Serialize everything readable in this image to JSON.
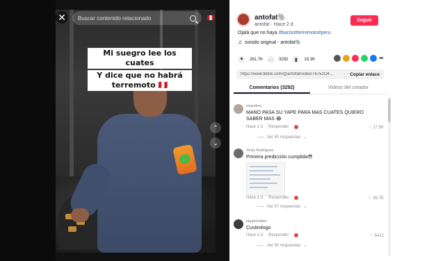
{
  "search": {
    "placeholder": "Buscar contenido relacionado"
  },
  "video": {
    "caption_line1": "Mi suegro lee los cuates",
    "caption_line2": "Y dice que no habrá terremoto 🇵🇪"
  },
  "author": {
    "name": "antofat🐘",
    "sub": "antofat · Hace 2 d",
    "follow_label": "Seguir"
  },
  "post": {
    "description_text": "Ojalá que no haya",
    "hashtags": [
      "#barzio",
      "#terremoto",
      "#peru"
    ],
    "sound": "sonido original - antofat🐘"
  },
  "stats": {
    "likes": "261.7K",
    "comments": "3292",
    "saves": "19.3K"
  },
  "link": {
    "url": "https://www.tiktok.com/@antofat/video/76752O4...",
    "copy_label": "Copiar enlace"
  },
  "tabs": [
    {
      "label": "Comentarios (3292)",
      "active": true
    },
    {
      "label": "Videos del creador",
      "active": false
    }
  ],
  "comments": [
    {
      "user": "maestroc",
      "text": "MANO PASA SU YAPE PARA MAS CUATES QUIERO SABER MAS 😂",
      "time": "Hace 1 d",
      "reply_label": "Responder",
      "likes": "17.5K",
      "view_replies": "Ver 40 respuestas"
    },
    {
      "user": "Yesly Rodriguez",
      "text": "Primera predicción cumplida😳",
      "time": "Hace 1 d",
      "reply_label": "Responder",
      "likes": "35.7K",
      "view_replies": "Ver 97 respuestas"
    },
    {
      "user": "elgatoroblex",
      "text": "Custeologo",
      "time": "Hace 1 d",
      "reply_label": "Responder",
      "likes": "5412",
      "view_replies": "Ver 60 respuestas"
    }
  ],
  "colors": {
    "follow": "#fe2c55",
    "hashtag": "#2b5db9",
    "text": "#161823"
  }
}
